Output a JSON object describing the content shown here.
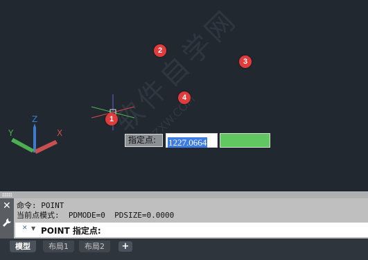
{
  "viewport": {
    "markers": [
      {
        "label": "1",
        "color": "#e23b3b"
      },
      {
        "label": "2",
        "color": "#e23b3b"
      },
      {
        "label": "3",
        "color": "#e23b3b"
      },
      {
        "label": "4",
        "color": "#e23b3b"
      }
    ],
    "ucs_axes": {
      "y": "Y",
      "z": "Z",
      "x": "X"
    },
    "watermark": {
      "text": "软件自学网",
      "url": "RJZXW.COM"
    },
    "dynamic_input": {
      "prompt": "指定点:",
      "value": "1227.0664"
    }
  },
  "command_window": {
    "history": [
      "命令: POINT",
      "当前点模式:  PDMODE=0  PDSIZE=0.0000"
    ],
    "prompt": "POINT 指定点:"
  },
  "layout_tabs": [
    {
      "label": "模型",
      "active": true
    },
    {
      "label": "布局1",
      "active": false
    },
    {
      "label": "布局2",
      "active": false
    }
  ],
  "colors": {
    "canvas": "#212830",
    "marker": "#e23b3b",
    "selection": "#3d7ce3",
    "green_field": "#61c761"
  }
}
